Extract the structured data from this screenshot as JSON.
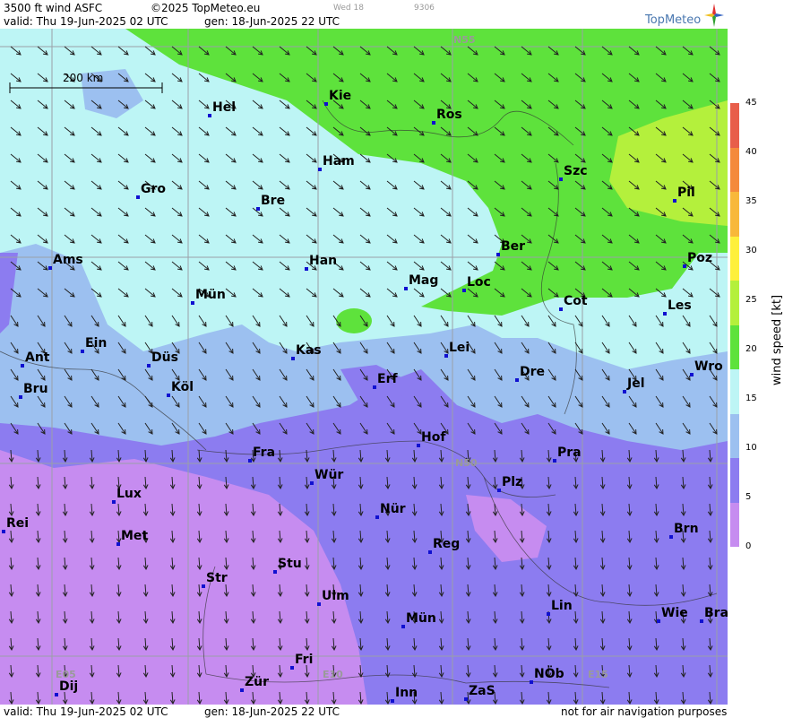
{
  "header": {
    "product": "3500 ft wind ASFC",
    "copyright": "©2025 TopMeteo.eu",
    "day": "Wed 18",
    "code": "9306",
    "valid": "valid:  Thu  19-Jun-2025  02 UTC",
    "gen": "gen: 18-Jun-2025 22 UTC",
    "brand": "TopMeteo"
  },
  "footer": {
    "valid": "valid:  Thu  19-Jun-2025  02 UTC",
    "gen": "gen: 18-Jun-2025 22 UTC",
    "note": "not for air navigation purposes"
  },
  "scale_label": "200 km",
  "legend": {
    "title": "wind speed  [kt]",
    "ticks": [
      "45",
      "40",
      "35",
      "30",
      "25",
      "20",
      "15",
      "10",
      "5",
      "0"
    ],
    "colors": [
      "#e85e4a",
      "#f48a3c",
      "#f8b83a",
      "#fef03c",
      "#b4f03c",
      "#5ee23c",
      "#bdf5f5",
      "#9cc0f0",
      "#8c7cf0",
      "#c68cf0"
    ]
  },
  "grid_labels": [
    {
      "text": "N55"
    },
    {
      "text": "N50"
    },
    {
      "text": "E05"
    },
    {
      "text": "E10"
    },
    {
      "text": "E15"
    }
  ],
  "cities": [
    {
      "name": "Hel"
    },
    {
      "name": "Kie"
    },
    {
      "name": "Ros"
    },
    {
      "name": "Ham"
    },
    {
      "name": "Szc"
    },
    {
      "name": "Gro"
    },
    {
      "name": "Bre"
    },
    {
      "name": "Pil"
    },
    {
      "name": "Ams"
    },
    {
      "name": "Han"
    },
    {
      "name": "Ber"
    },
    {
      "name": "Poz"
    },
    {
      "name": "Mag"
    },
    {
      "name": "Loc"
    },
    {
      "name": "Mün"
    },
    {
      "name": "Cot"
    },
    {
      "name": "Les"
    },
    {
      "name": "Ein"
    },
    {
      "name": "Kas"
    },
    {
      "name": "Lei"
    },
    {
      "name": "Ant"
    },
    {
      "name": "Düs"
    },
    {
      "name": "Dre"
    },
    {
      "name": "Wro"
    },
    {
      "name": "Bru"
    },
    {
      "name": "Köl"
    },
    {
      "name": "Erf"
    },
    {
      "name": "Jel"
    },
    {
      "name": "Hof"
    },
    {
      "name": "Fra"
    },
    {
      "name": "Pra"
    },
    {
      "name": "Wür"
    },
    {
      "name": "Plz"
    },
    {
      "name": "Lux"
    },
    {
      "name": "Nür"
    },
    {
      "name": "Rei"
    },
    {
      "name": "Brn"
    },
    {
      "name": "Met"
    },
    {
      "name": "Reg"
    },
    {
      "name": "Stu"
    },
    {
      "name": "Str"
    },
    {
      "name": "Ulm"
    },
    {
      "name": "Lin"
    },
    {
      "name": "Wie"
    },
    {
      "name": "Bra"
    },
    {
      "name": "Mün"
    },
    {
      "name": "Fri"
    },
    {
      "name": "NÖb"
    },
    {
      "name": "Dij"
    },
    {
      "name": "Zür"
    },
    {
      "name": "Inn"
    },
    {
      "name": "ZaS"
    }
  ]
}
